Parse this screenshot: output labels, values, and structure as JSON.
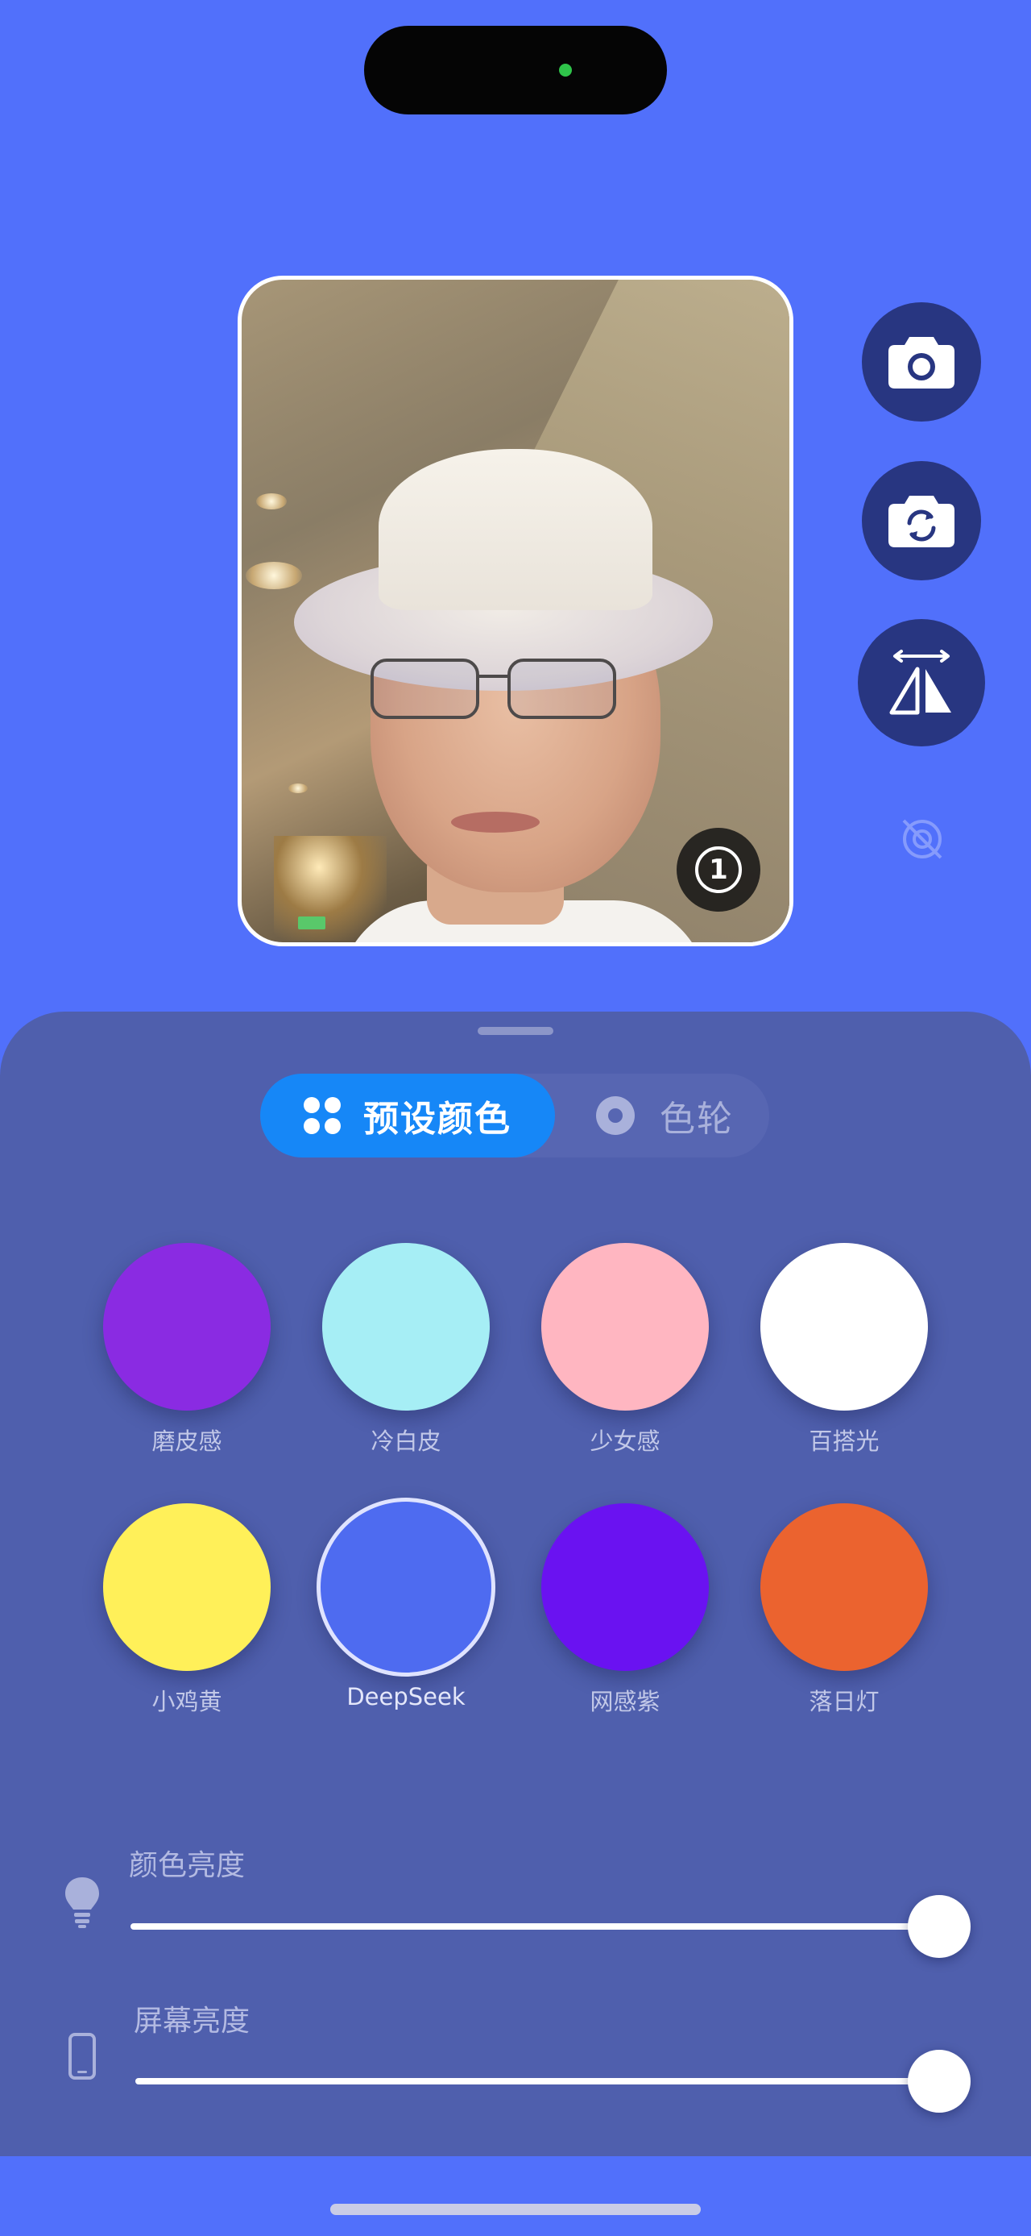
{
  "preview": {
    "timer_value": "1"
  },
  "side_controls": [
    {
      "name": "camera-icon"
    },
    {
      "name": "switch-camera-icon"
    },
    {
      "name": "mirror-icon"
    },
    {
      "name": "rotation-lock-icon"
    }
  ],
  "tabs": [
    {
      "label": "预设颜色",
      "icon": "grid-dots-icon",
      "active": true
    },
    {
      "label": "色轮",
      "icon": "color-wheel-icon",
      "active": false
    }
  ],
  "swatches": [
    {
      "label": "磨皮感",
      "color": "#8A2BE2"
    },
    {
      "label": "冷白皮",
      "color": "#A6EEF5"
    },
    {
      "label": "少女感",
      "color": "#FFB6C1"
    },
    {
      "label": "百搭光",
      "color": "#FFFFFF"
    },
    {
      "label": "小鸡黄",
      "color": "#FFF059"
    },
    {
      "label": "DeepSeek",
      "color": "#4E6BF0",
      "selected": true
    },
    {
      "label": "网感紫",
      "color": "#6A12F1"
    },
    {
      "label": "落日灯",
      "color": "#EB632F"
    }
  ],
  "sliders": {
    "color_brightness": {
      "label": "颜色亮度",
      "value": 1.0,
      "icon": "lightbulb-icon"
    },
    "screen_brightness": {
      "label": "屏幕亮度",
      "value": 1.0,
      "icon": "phone-icon"
    }
  },
  "colors": {
    "background": "#5170FB",
    "sheet": "#4F5FAD",
    "accent": "#1687F7",
    "button": "#283681"
  }
}
